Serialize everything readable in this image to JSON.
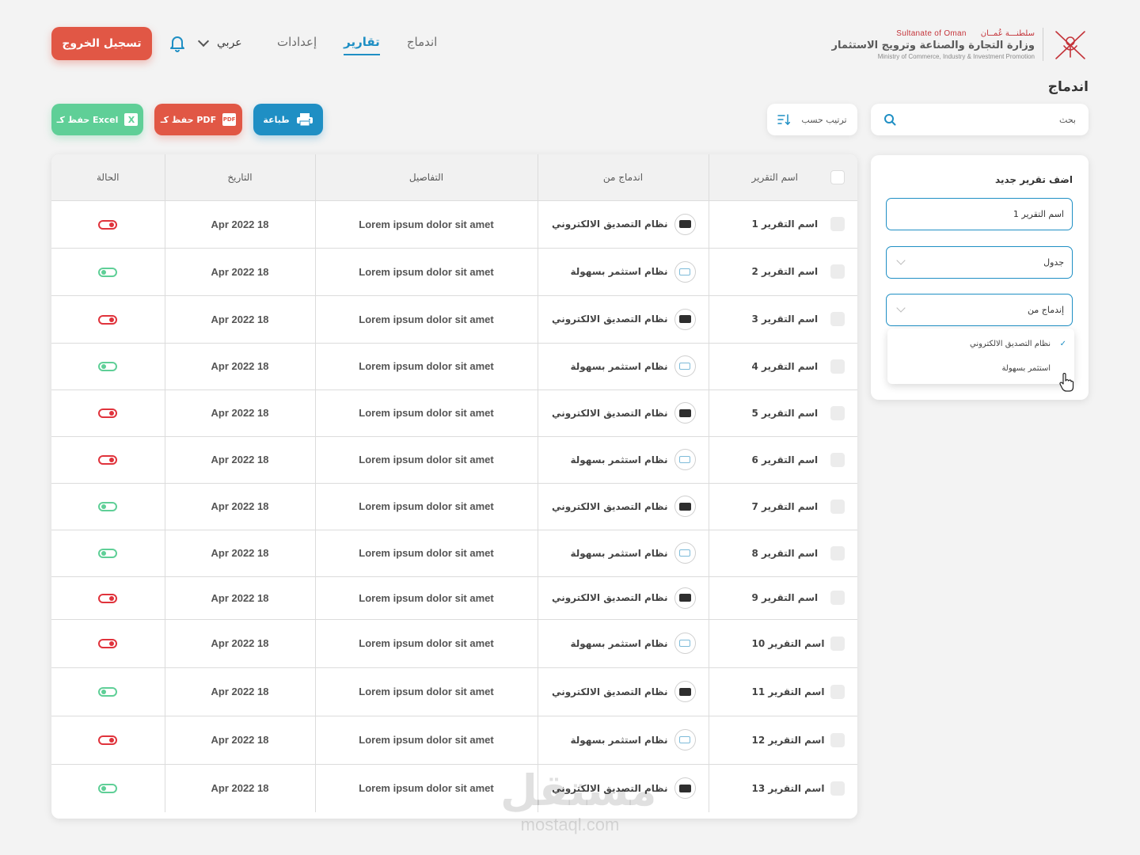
{
  "header": {
    "logo": {
      "ar_top": "سلطنـــة عُمــان",
      "en_top": "Sultanate of Oman",
      "ministry_ar": "وزارة التجارة والصناعة وترويج الاستثمار",
      "ministry_en": "Ministry of Commerce, Industry & Investment Promotion"
    },
    "nav": [
      {
        "label": "إعدادات",
        "active": false
      },
      {
        "label": "تقارير",
        "active": true
      },
      {
        "label": "اندماج",
        "active": false
      }
    ],
    "language": "عربي",
    "logout_label": "تسجيل الخروج"
  },
  "page": {
    "title": "اندماج"
  },
  "toolbar": {
    "search_placeholder": "بحث",
    "sort_label": "ترتيب حسب",
    "print_label": "طباعة",
    "pdf_label": "PDF حفظ كـ",
    "pdf_icon_text": "PDF",
    "excel_label": "Excel حفظ كـ",
    "excel_icon_text": "X"
  },
  "table": {
    "columns": [
      "اسم التقرير",
      "اندماج من",
      "التفاصيل",
      "التاريخ",
      "الحالة"
    ],
    "rows": [
      {
        "name": "اسم التقرير 1",
        "from": "نظام التصديق الالكتروني",
        "from_icon": "dark",
        "details": "Lorem ipsum dolor sit amet",
        "date": "18 Apr 2022",
        "status": "on"
      },
      {
        "name": "اسم التقرير 2",
        "from": "نظام استثمر بسهولة",
        "from_icon": "light",
        "details": "Lorem ipsum dolor sit amet",
        "date": "18 Apr 2022",
        "status": "off"
      },
      {
        "name": "اسم التقرير 3",
        "from": "نظام التصديق الالكتروني",
        "from_icon": "dark",
        "details": "Lorem ipsum dolor sit amet",
        "date": "18 Apr 2022",
        "status": "on"
      },
      {
        "name": "اسم التقرير 4",
        "from": "نظام استثمر بسهولة",
        "from_icon": "light",
        "details": "Lorem ipsum dolor sit amet",
        "date": "18 Apr 2022",
        "status": "off"
      },
      {
        "name": "اسم التقرير 5",
        "from": "نظام التصديق الالكتروني",
        "from_icon": "dark",
        "details": "Lorem ipsum dolor sit amet",
        "date": "18 Apr 2022",
        "status": "on"
      },
      {
        "name": "اسم التقرير 6",
        "from": "نظام استثمر بسهولة",
        "from_icon": "light",
        "details": "Lorem ipsum dolor sit amet",
        "date": "18 Apr 2022",
        "status": "on"
      },
      {
        "name": "اسم التقرير 7",
        "from": "نظام التصديق الالكتروني",
        "from_icon": "dark",
        "details": "Lorem ipsum dolor sit amet",
        "date": "18 Apr 2022",
        "status": "off"
      },
      {
        "name": "اسم التقرير 8",
        "from": "نظام استثمر بسهولة",
        "from_icon": "light",
        "details": "Lorem ipsum dolor sit amet",
        "date": "18 Apr 2022",
        "status": "off"
      },
      {
        "name": "اسم التقرير 9",
        "from": "نظام التصديق الالكتروني",
        "from_icon": "dark",
        "details": "Lorem ipsum dolor sit amet",
        "date": "18 Apr 2022",
        "status": "on"
      },
      {
        "name": "اسم التقرير 10",
        "from": "نظام استثمر بسهولة",
        "from_icon": "light",
        "details": "Lorem ipsum dolor sit amet",
        "date": "18 Apr 2022",
        "status": "on"
      },
      {
        "name": "اسم التقرير 11",
        "from": "نظام التصديق الالكتروني",
        "from_icon": "dark",
        "details": "Lorem ipsum dolor sit amet",
        "date": "18 Apr 2022",
        "status": "off"
      },
      {
        "name": "اسم التقرير 12",
        "from": "نظام استثمر بسهولة",
        "from_icon": "light",
        "details": "Lorem ipsum dolor sit amet",
        "date": "18 Apr 2022",
        "status": "on"
      },
      {
        "name": "اسم التقرير 13",
        "from": "نظام التصديق الالكتروني",
        "from_icon": "dark",
        "details": "Lorem ipsum dolor sit amet",
        "date": "18 Apr 2022",
        "status": "off"
      }
    ]
  },
  "side_form": {
    "title": "اضف تقرير جديد",
    "report_name_value": "اسم التقرير 1",
    "type_value": "جدول",
    "merge_from_placeholder": "إندماج من",
    "options": [
      {
        "label": "نظام التصديق الالكتروني",
        "checked": true
      },
      {
        "label": "استثمر بسهولة",
        "checked": false
      }
    ]
  },
  "watermark": {
    "ar": "مستقل",
    "en": "mostaql.com"
  },
  "colors": {
    "primary": "#1f8fc4",
    "danger": "#e15745",
    "success": "#5fcf97",
    "toggle_on": "#e0333c"
  }
}
